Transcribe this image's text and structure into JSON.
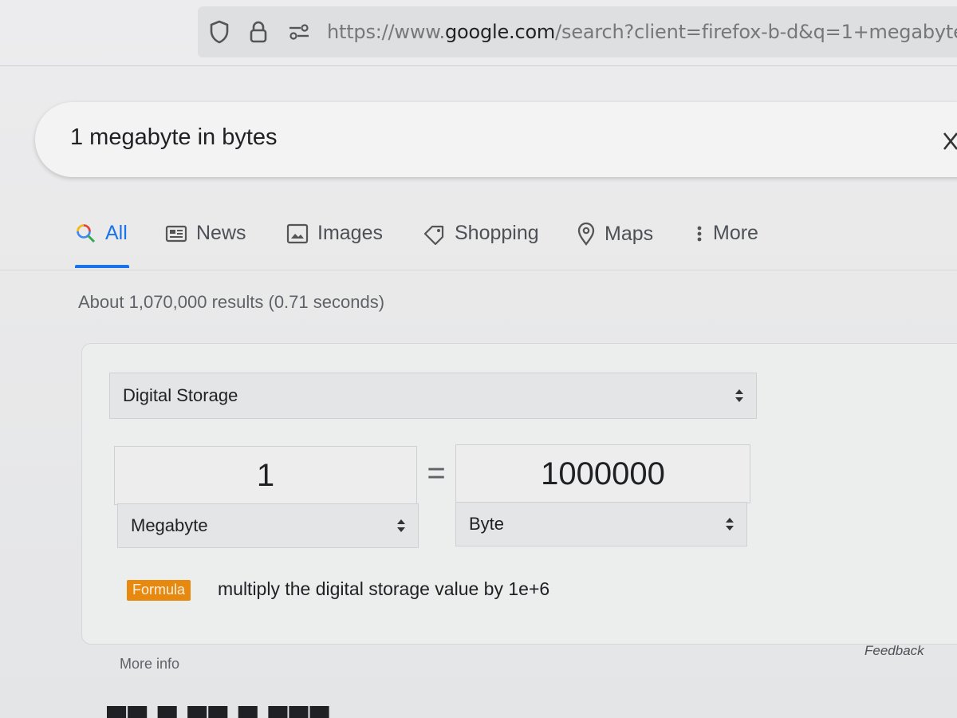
{
  "browser": {
    "url_prefix": "https://www.",
    "url_host": "google.com",
    "url_path": "/search?client=firefox-b-d&q=1+megabyte"
  },
  "search": {
    "query": "1 megabyte in bytes"
  },
  "tabs": [
    {
      "label": "All",
      "icon": "search-icon",
      "active": true
    },
    {
      "label": "News",
      "icon": "news-icon"
    },
    {
      "label": "Images",
      "icon": "image-icon"
    },
    {
      "label": "Shopping",
      "icon": "tag-icon"
    },
    {
      "label": "Maps",
      "icon": "map-pin-icon"
    },
    {
      "label": "More",
      "icon": "vertical-dots-icon"
    }
  ],
  "results": {
    "stats": "About 1,070,000 results (0.71 seconds)"
  },
  "converter": {
    "category": "Digital Storage",
    "from_value": "1",
    "from_unit": "Megabyte",
    "equals": "=",
    "to_value": "1000000",
    "to_unit": "Byte",
    "formula_label": "Formula",
    "formula_text": "multiply the digital storage value by 1e+6"
  },
  "footer": {
    "more_info": "More info",
    "feedback": "Feedback"
  },
  "colors": {
    "accent": "#1a73e8",
    "formula_badge": "#e8890f"
  }
}
